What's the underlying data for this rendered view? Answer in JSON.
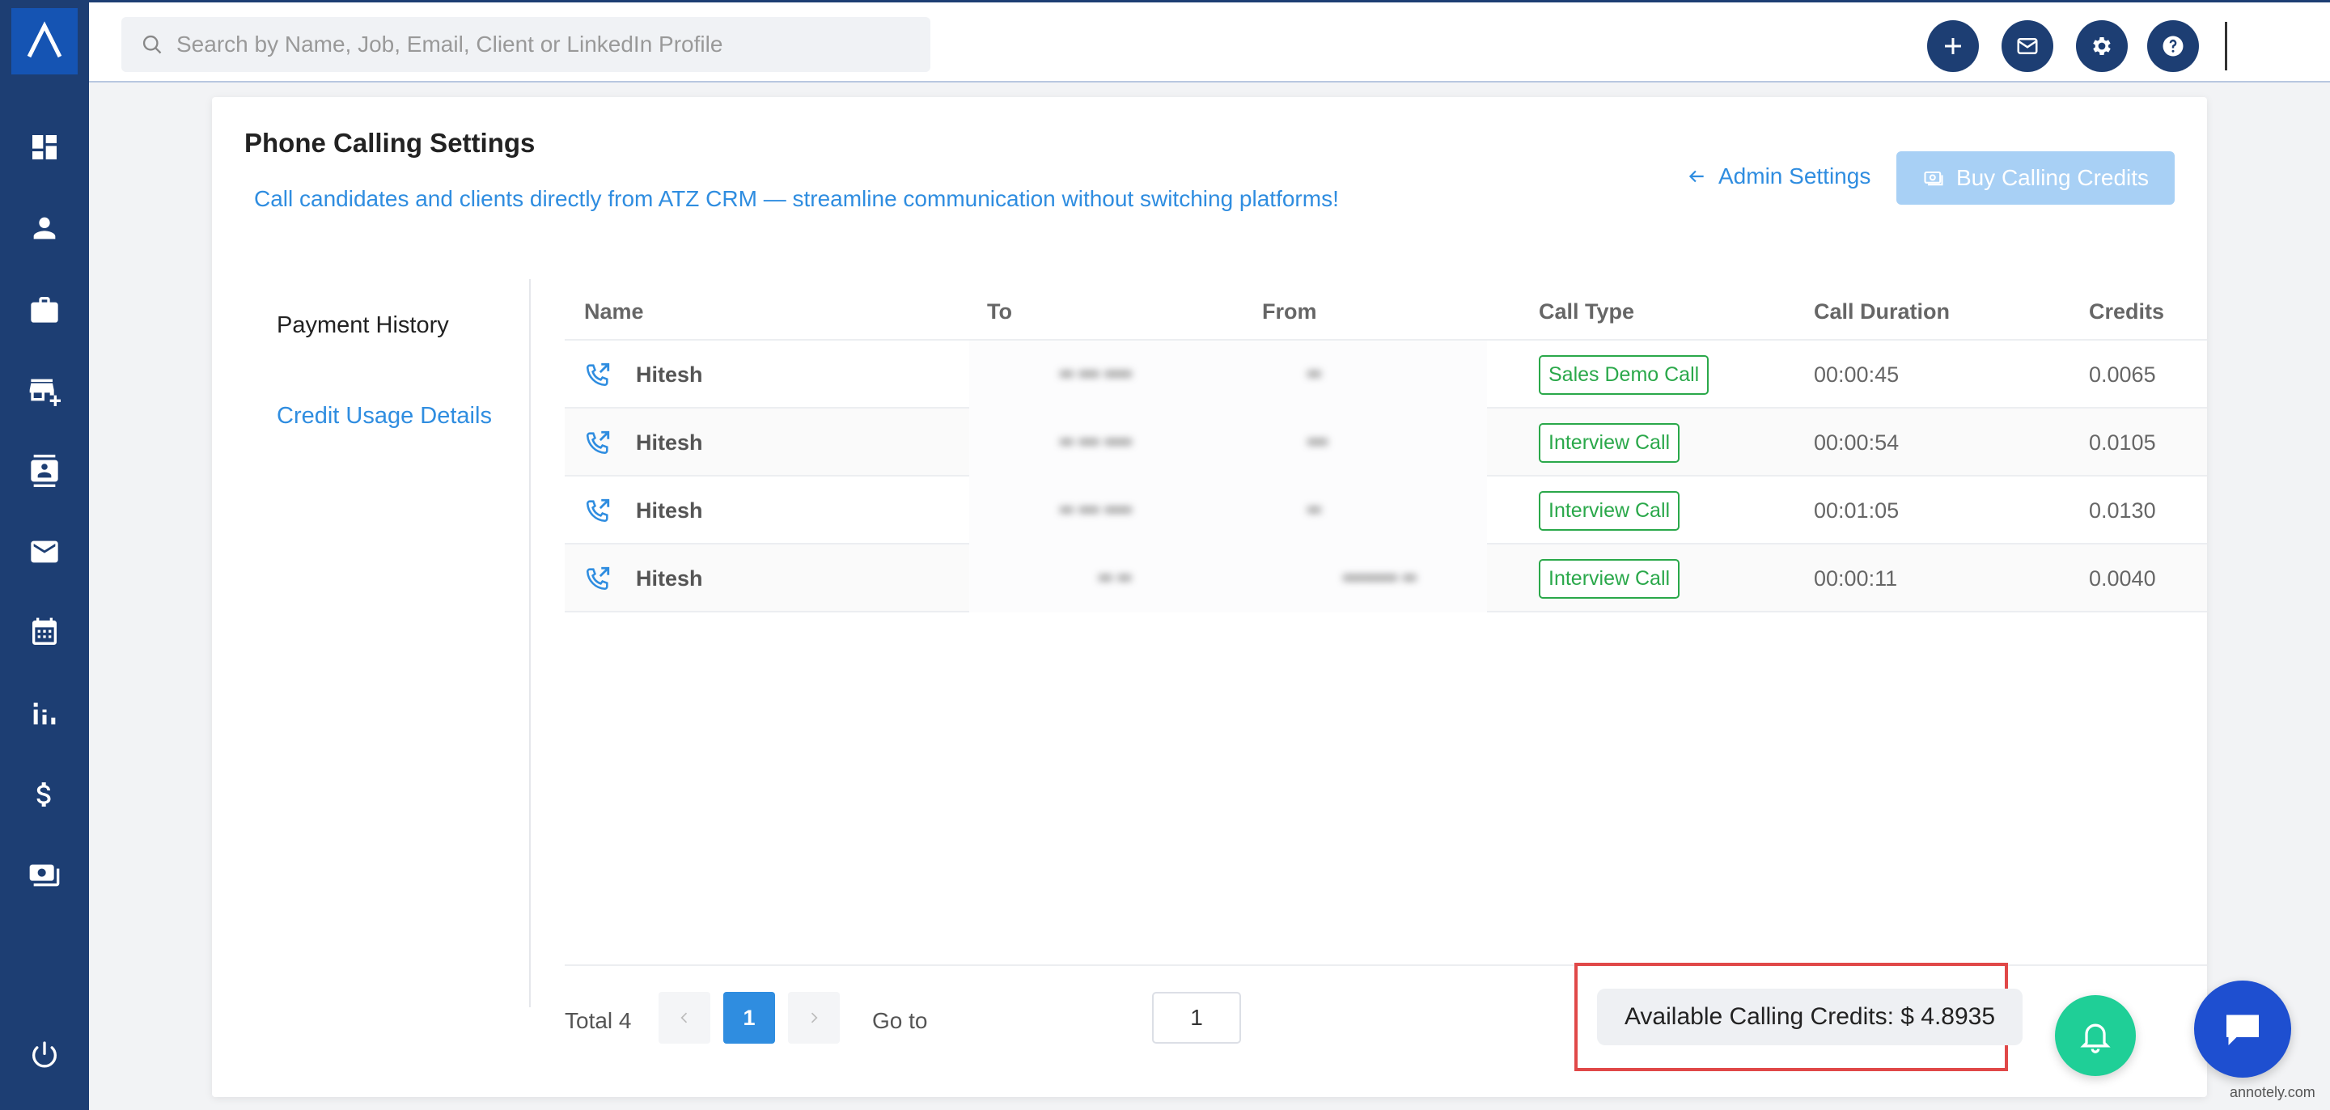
{
  "search": {
    "placeholder": "Search by Name, Job, Email, Client or LinkedIn Profile"
  },
  "page": {
    "title": "Phone Calling Settings",
    "subtitle": "Call candidates and clients directly from ATZ CRM — streamline communication without switching platforms!",
    "admin_link": "Admin Settings",
    "buy_button": "Buy Calling Credits"
  },
  "tabs": [
    {
      "label": "Payment History",
      "active": false
    },
    {
      "label": "Credit Usage Details",
      "active": true
    }
  ],
  "table": {
    "columns": [
      "Name",
      "To",
      "From",
      "Call Type",
      "Call Duration",
      "Credits"
    ],
    "rows": [
      {
        "name": "Hitesh",
        "to": "•• ••• ••••",
        "from": "••",
        "call_type": "Sales Demo Call",
        "duration": "00:00:45",
        "credits": "0.0065"
      },
      {
        "name": "Hitesh",
        "to": "•• ••• ••••",
        "from": "•••",
        "call_type": "Interview Call",
        "duration": "00:00:54",
        "credits": "0.0105"
      },
      {
        "name": "Hitesh",
        "to": "•• ••• ••••",
        "from": "••",
        "call_type": "Interview Call",
        "duration": "00:01:05",
        "credits": "0.0130"
      },
      {
        "name": "Hitesh",
        "to": "•• ••",
        "from": "•••••••• ••",
        "call_type": "Interview Call",
        "duration": "00:00:11",
        "credits": "0.0040"
      }
    ]
  },
  "pagination": {
    "total": "Total 4",
    "current_page": "1",
    "goto_label": "Go to",
    "goto_value": "1"
  },
  "credits": {
    "label": "Available Calling Credits: $ 4.8935"
  },
  "watermark": "annotely.com",
  "colors": {
    "sidebar": "#1d3e73",
    "accent": "#2f8de0",
    "tag": "#2aa84a",
    "highlight": "#e04848",
    "bell": "#1fcf97",
    "chat": "#1e4fd0"
  },
  "icons": {
    "sidebar": [
      "dashboard-icon",
      "person-icon",
      "briefcase-icon",
      "store-add-icon",
      "contact-card-icon",
      "mail-icon",
      "calendar-icon",
      "bar-chart-icon",
      "dollar-icon",
      "payments-icon",
      "power-icon"
    ],
    "topbar": [
      "plus-icon",
      "mail-icon",
      "gear-icon",
      "help-icon"
    ]
  }
}
